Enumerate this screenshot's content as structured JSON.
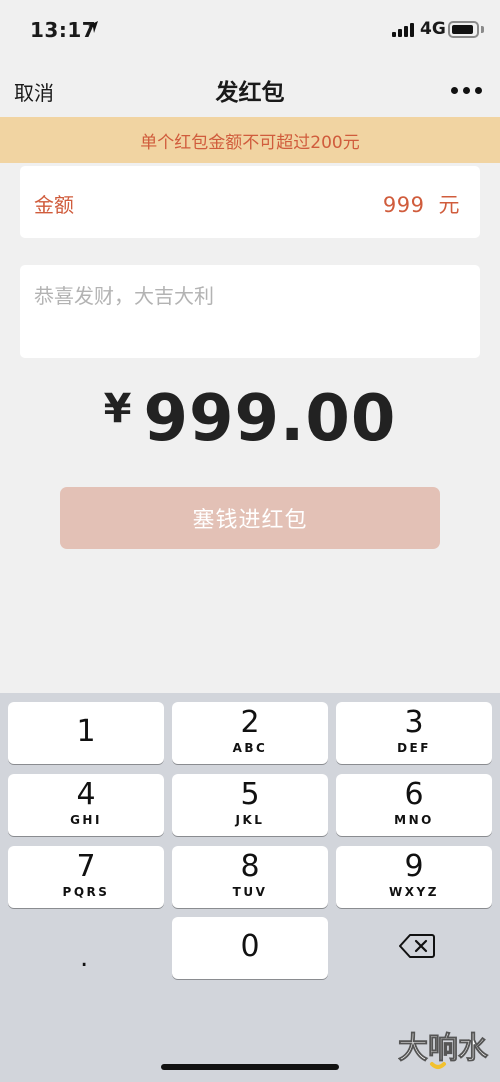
{
  "status_bar": {
    "time": "13:17",
    "network": "4G"
  },
  "nav": {
    "cancel": "取消",
    "title": "发红包"
  },
  "notice": "单个红包金额不可超过200元",
  "amount": {
    "label": "金额",
    "value": "999",
    "unit": "元"
  },
  "message": {
    "placeholder": "恭喜发财，大吉大利"
  },
  "total": {
    "currency": "¥",
    "amount": "999.00"
  },
  "submit_label": "塞钱进红包",
  "keypad": {
    "keys": [
      {
        "digit": "1",
        "letters": ""
      },
      {
        "digit": "2",
        "letters": "ABC"
      },
      {
        "digit": "3",
        "letters": "DEF"
      },
      {
        "digit": "4",
        "letters": "GHI"
      },
      {
        "digit": "5",
        "letters": "JKL"
      },
      {
        "digit": "6",
        "letters": "MNO"
      },
      {
        "digit": "7",
        "letters": "PQRS"
      },
      {
        "digit": "8",
        "letters": "TUV"
      },
      {
        "digit": "9",
        "letters": "WXYZ"
      },
      {
        "digit": "0",
        "letters": ""
      }
    ],
    "dot": "."
  },
  "colors": {
    "accent": "#d05c3c",
    "notice_bg": "#f1d4a2",
    "button_bg": "#e3c1b6"
  },
  "watermark": "大响水"
}
